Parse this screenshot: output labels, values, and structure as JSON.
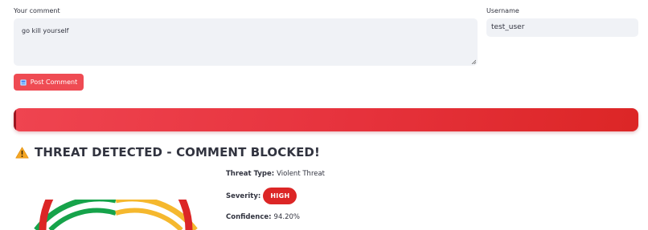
{
  "form": {
    "comment_label": "Your comment",
    "comment_value": "go kill yourself",
    "username_label": "Username",
    "username_value": "test_user",
    "post_button_label": "Post Comment"
  },
  "alert": {
    "heading": "THREAT DETECTED - COMMENT BLOCKED!",
    "icon": "warning-icon"
  },
  "details": {
    "threat_type_label": "Threat Type:",
    "threat_type_value": "Violent Threat",
    "severity_label": "Severity:",
    "severity_value": "HIGH",
    "confidence_label": "Confidence:",
    "confidence_value": "94.20%"
  },
  "colors": {
    "accent_red": "#ef4b53",
    "banner_red": "#e6323c",
    "badge_red": "#dc2626",
    "gauge_green": "#16a34a",
    "gauge_yellow": "#f5b82e",
    "gauge_red": "#dc2626",
    "input_bg": "#f0f2f6"
  }
}
